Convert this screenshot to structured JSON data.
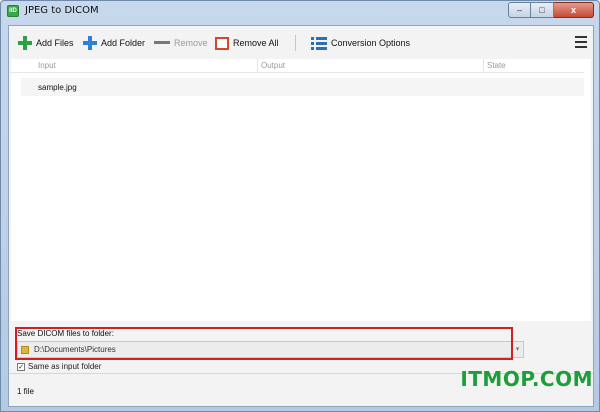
{
  "window": {
    "title": "JPEG to DICOM",
    "app_icon_text": "IID",
    "controls": {
      "minimize": "–",
      "maximize": "□",
      "close": "x"
    }
  },
  "toolbar": {
    "add_files": "Add Files",
    "add_folder": "Add Folder",
    "remove": "Remove",
    "remove_all": "Remove All",
    "conversion_options": "Conversion Options"
  },
  "table": {
    "columns": [
      "Input",
      "Output",
      "State"
    ],
    "rows": [
      {
        "input": "sample.jpg",
        "output": "",
        "state": ""
      }
    ]
  },
  "save": {
    "label": "Save DICOM files to folder:",
    "path": "D:\\Documents\\Pictures",
    "dropdown_icon": "▾",
    "same_as_input_label": "Same as input folder",
    "same_as_input_checked": true,
    "check_glyph": "✓"
  },
  "status": {
    "count": "1 file"
  },
  "watermark": "ITMOP.COM",
  "colors": {
    "add_files_icon": "#2ea043",
    "add_folder_icon": "#2f7fd6",
    "remove_all_icon": "#d04a2a",
    "highlight": "#d21f24",
    "watermark": "#1f9d3a"
  }
}
